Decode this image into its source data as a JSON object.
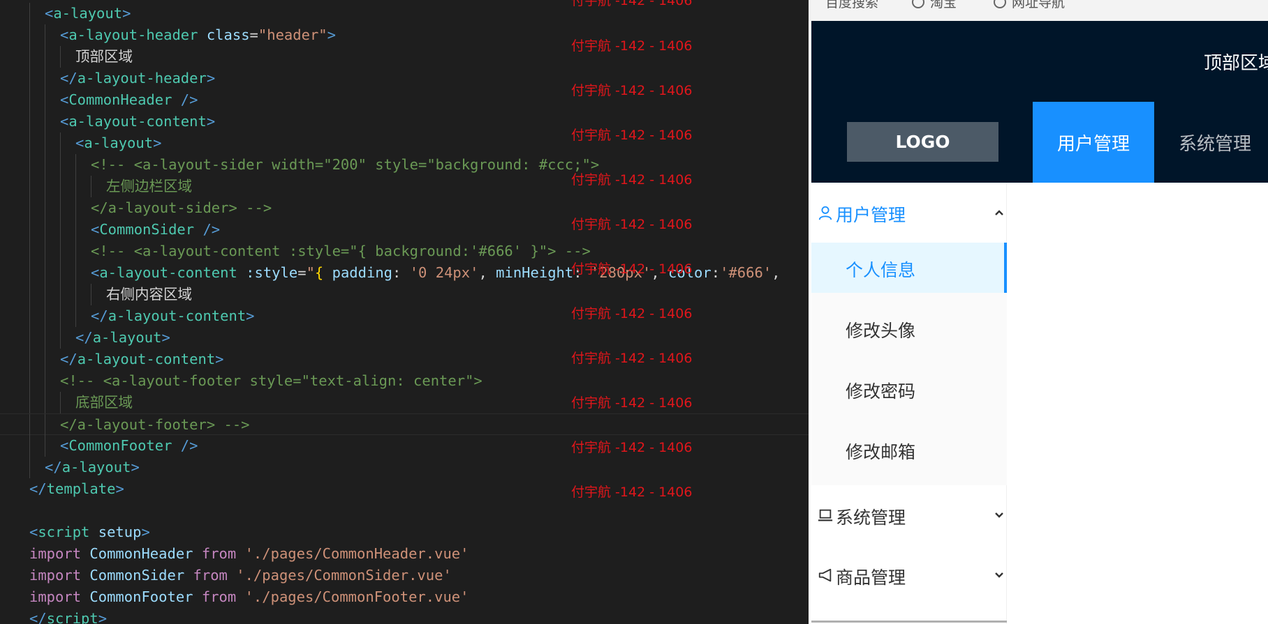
{
  "watermark": "付宇航 -142 - 1406",
  "editor": {
    "lines": [
      {
        "indent": 1,
        "tokens": [
          [
            "tag",
            "<"
          ],
          [
            "comp",
            "a-layout"
          ],
          [
            "tag",
            ">"
          ]
        ]
      },
      {
        "indent": 2,
        "tokens": [
          [
            "tag",
            "<"
          ],
          [
            "comp",
            "a-layout-header"
          ],
          [
            "text",
            " "
          ],
          [
            "attr",
            "class"
          ],
          [
            "text",
            "="
          ],
          [
            "str",
            "\"header\""
          ],
          [
            "tag",
            ">"
          ]
        ]
      },
      {
        "indent": 3,
        "tokens": [
          [
            "text",
            "顶部区域"
          ]
        ]
      },
      {
        "indent": 2,
        "tokens": [
          [
            "tag",
            "</"
          ],
          [
            "comp",
            "a-layout-header"
          ],
          [
            "tag",
            ">"
          ]
        ]
      },
      {
        "indent": 2,
        "tokens": [
          [
            "tag",
            "<"
          ],
          [
            "comp",
            "CommonHeader"
          ],
          [
            "text",
            " "
          ],
          [
            "tag",
            "/>"
          ]
        ]
      },
      {
        "indent": 2,
        "tokens": [
          [
            "tag",
            "<"
          ],
          [
            "comp",
            "a-layout-content"
          ],
          [
            "tag",
            ">"
          ]
        ]
      },
      {
        "indent": 3,
        "tokens": [
          [
            "tag",
            "<"
          ],
          [
            "comp",
            "a-layout"
          ],
          [
            "tag",
            ">"
          ]
        ]
      },
      {
        "indent": 4,
        "tokens": [
          [
            "comment",
            "<!-- <a-layout-sider width=\"200\" style=\"background: #ccc;\">"
          ]
        ]
      },
      {
        "indent": 5,
        "tokens": [
          [
            "comment",
            "左侧边栏区域"
          ]
        ]
      },
      {
        "indent": 4,
        "tokens": [
          [
            "comment",
            "</a-layout-sider> -->"
          ]
        ]
      },
      {
        "indent": 4,
        "tokens": [
          [
            "tag",
            "<"
          ],
          [
            "comp",
            "CommonSider"
          ],
          [
            "text",
            " "
          ],
          [
            "tag",
            "/>"
          ]
        ]
      },
      {
        "indent": 4,
        "tokens": [
          [
            "comment",
            "<!-- <a-layout-content :style=\"{ background:'#666' }\"> -->"
          ]
        ]
      },
      {
        "indent": 4,
        "tokens": [
          [
            "tag",
            "<"
          ],
          [
            "comp",
            "a-layout-content"
          ],
          [
            "text",
            " "
          ],
          [
            "attr",
            ":style"
          ],
          [
            "text",
            "="
          ],
          [
            "str",
            "\""
          ],
          [
            "brace",
            "{"
          ],
          [
            "text",
            " "
          ],
          [
            "id",
            "padding"
          ],
          [
            "text",
            ": "
          ],
          [
            "str",
            "'0 24px'"
          ],
          [
            "text",
            ", "
          ],
          [
            "id",
            "minHeight"
          ],
          [
            "text",
            ": "
          ],
          [
            "str",
            "'280px'"
          ],
          [
            "text",
            ", "
          ],
          [
            "id",
            "color"
          ],
          [
            "text",
            ":"
          ],
          [
            "str",
            "'#666'"
          ],
          [
            "text",
            ","
          ]
        ]
      },
      {
        "indent": 5,
        "tokens": [
          [
            "text",
            "右侧内容区域"
          ]
        ]
      },
      {
        "indent": 4,
        "tokens": [
          [
            "tag",
            "</"
          ],
          [
            "comp",
            "a-layout-content"
          ],
          [
            "tag",
            ">"
          ]
        ]
      },
      {
        "indent": 3,
        "tokens": [
          [
            "tag",
            "</"
          ],
          [
            "comp",
            "a-layout"
          ],
          [
            "tag",
            ">"
          ]
        ]
      },
      {
        "indent": 2,
        "tokens": [
          [
            "tag",
            "</"
          ],
          [
            "comp",
            "a-layout-content"
          ],
          [
            "tag",
            ">"
          ]
        ]
      },
      {
        "indent": 2,
        "tokens": [
          [
            "comment",
            "<!-- <a-layout-footer style=\"text-align: center\">"
          ]
        ]
      },
      {
        "indent": 3,
        "tokens": [
          [
            "comment",
            "底部区域"
          ]
        ]
      },
      {
        "indent": 2,
        "current": true,
        "tokens": [
          [
            "comment",
            "</a-layout-footer> -->"
          ]
        ]
      },
      {
        "indent": 2,
        "tokens": [
          [
            "tag",
            "<"
          ],
          [
            "comp",
            "CommonFooter"
          ],
          [
            "text",
            " "
          ],
          [
            "tag",
            "/>"
          ]
        ]
      },
      {
        "indent": 1,
        "tokens": [
          [
            "tag",
            "</"
          ],
          [
            "comp",
            "a-layout"
          ],
          [
            "tag",
            ">"
          ]
        ]
      },
      {
        "indent": 0,
        "tokens": [
          [
            "tag",
            "</"
          ],
          [
            "comp",
            "template"
          ],
          [
            "tag",
            ">"
          ]
        ]
      },
      {
        "indent": 0,
        "tokens": []
      },
      {
        "indent": 0,
        "tokens": [
          [
            "tag",
            "<"
          ],
          [
            "comp",
            "script"
          ],
          [
            "text",
            " "
          ],
          [
            "attr",
            "setup"
          ],
          [
            "tag",
            ">"
          ]
        ]
      },
      {
        "indent": 0,
        "tokens": [
          [
            "kw",
            "import"
          ],
          [
            "text",
            " "
          ],
          [
            "id",
            "CommonHeader"
          ],
          [
            "text",
            " "
          ],
          [
            "kw",
            "from"
          ],
          [
            "text",
            " "
          ],
          [
            "str",
            "'./pages/CommonHeader.vue'"
          ]
        ]
      },
      {
        "indent": 0,
        "tokens": [
          [
            "kw",
            "import"
          ],
          [
            "text",
            " "
          ],
          [
            "id",
            "CommonSider"
          ],
          [
            "text",
            " "
          ],
          [
            "kw",
            "from"
          ],
          [
            "text",
            " "
          ],
          [
            "str",
            "'./pages/CommonSider.vue'"
          ]
        ]
      },
      {
        "indent": 0,
        "tokens": [
          [
            "kw",
            "import"
          ],
          [
            "text",
            " "
          ],
          [
            "id",
            "CommonFooter"
          ],
          [
            "text",
            " "
          ],
          [
            "kw",
            "from"
          ],
          [
            "text",
            " "
          ],
          [
            "str",
            "'./pages/CommonFooter.vue'"
          ]
        ]
      },
      {
        "indent": 0,
        "tokens": [
          [
            "tag",
            "</"
          ],
          [
            "comp",
            "script"
          ],
          [
            "tag",
            ">"
          ]
        ]
      }
    ]
  },
  "browser": {
    "bookmarks": [
      "百度搜索",
      "淘宝",
      "网址导航"
    ],
    "header_title": "顶部区域",
    "logo": "LOGO",
    "top_nav": [
      "用户管理",
      "系统管理"
    ],
    "sider": {
      "user_menu": "用户管理",
      "user_items": [
        "个人信息",
        "修改头像",
        "修改密码",
        "修改邮箱"
      ],
      "selected": "个人信息",
      "system_menu": "系统管理",
      "goods_menu": "商品管理"
    }
  },
  "colors": {
    "primary": "#1890ff",
    "header_bg": "#001529",
    "logo_bg": "#4c5a67",
    "watermark": "#e0161b"
  },
  "icons": {
    "user_menu": "user-icon",
    "system_menu": "laptop-icon",
    "goods_menu": "notification-icon"
  }
}
